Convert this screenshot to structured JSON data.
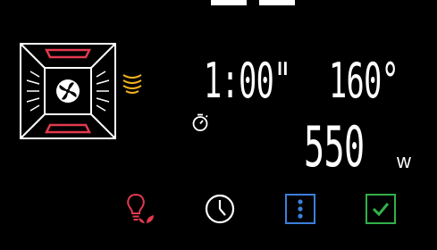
{
  "display": {
    "time": "1:00\"",
    "temperature": "160°",
    "power_value": "550",
    "power_unit": "w"
  },
  "icons": {
    "oven": "oven-fan-icon",
    "microwave": "microwave-waves-icon",
    "timer": "stopwatch-icon",
    "lamp": "lamp-eco-icon",
    "clock": "clock-icon",
    "menu": "vertical-dots-menu-icon",
    "confirm": "checkmark-icon"
  },
  "colors": {
    "background": "#000000",
    "heating_element": "#e23a4e",
    "microwave": "#f2b31c",
    "menu_blue": "#3d7fdc",
    "confirm_green": "#33b04a",
    "text": "#ffffff"
  }
}
